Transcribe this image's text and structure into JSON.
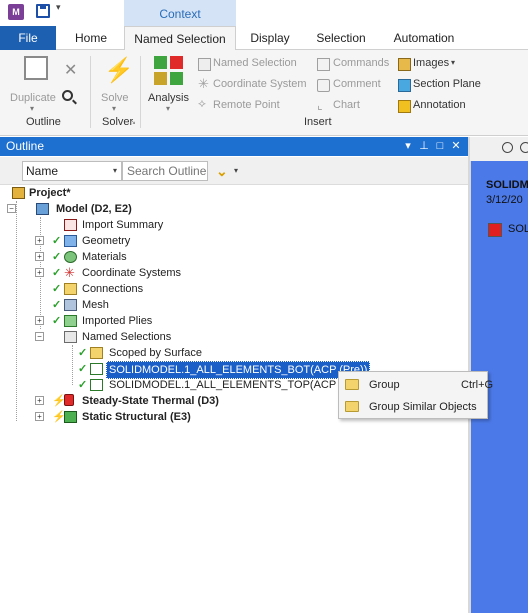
{
  "title_bar": {
    "app_logo": "M",
    "context_tab": "Context"
  },
  "tabs": [
    "File",
    "Home",
    "Named Selection",
    "Display",
    "Selection",
    "Automation"
  ],
  "ribbon": {
    "outline_group": {
      "duplicate": "Duplicate",
      "label": "Outline"
    },
    "solver_group": {
      "solve": "Solve",
      "label": "Solver"
    },
    "insert_group": {
      "analysis": "Analysis",
      "named_selection": "Named Selection",
      "coordinate_system": "Coordinate System",
      "remote_point": "Remote Point",
      "commands": "Commands",
      "comment": "Comment",
      "chart": "Chart",
      "images": "Images",
      "section_plane": "Section Plane",
      "annotation": "Annotation",
      "label": "Insert"
    }
  },
  "outline": {
    "title": "Outline",
    "filter_value": "Name",
    "search_placeholder": "Search Outline",
    "tree": [
      {
        "label": "Project*",
        "level": 0,
        "bold": true
      },
      {
        "label": "Model (D2, E2)",
        "level": 1,
        "bold": true
      },
      {
        "label": "Import Summary",
        "level": 2
      },
      {
        "label": "Geometry",
        "level": 2
      },
      {
        "label": "Materials",
        "level": 2
      },
      {
        "label": "Coordinate Systems",
        "level": 2
      },
      {
        "label": "Connections",
        "level": 2
      },
      {
        "label": "Mesh",
        "level": 2
      },
      {
        "label": "Imported Plies",
        "level": 2
      },
      {
        "label": "Named Selections",
        "level": 2
      },
      {
        "label": "Scoped by Surface",
        "level": 3
      },
      {
        "label": "SOLIDMODEL.1_ALL_ELEMENTS_BOT(ACP (Pre))",
        "level": 3,
        "selected": true
      },
      {
        "label": "SOLIDMODEL.1_ALL_ELEMENTS_TOP(ACP (Pre))",
        "level": 3
      },
      {
        "label": "Steady-State Thermal (D3)",
        "level": 1,
        "bold": true
      },
      {
        "label": "Static Structural (E3)",
        "level": 1,
        "bold": true
      }
    ]
  },
  "context_menu": [
    {
      "label": "Group",
      "shortcut": "Ctrl+G"
    },
    {
      "label": "Group Similar Objects",
      "shortcut": ""
    }
  ],
  "geometry_panel": {
    "title": "SOLIDM",
    "date": "3/12/20",
    "legend_label": "SOL"
  },
  "colors": {
    "accent": "#1d6fd0",
    "file_tab": "#1d5fb0",
    "selection": "#1a5fc8",
    "viewport": "#4b79e8"
  }
}
